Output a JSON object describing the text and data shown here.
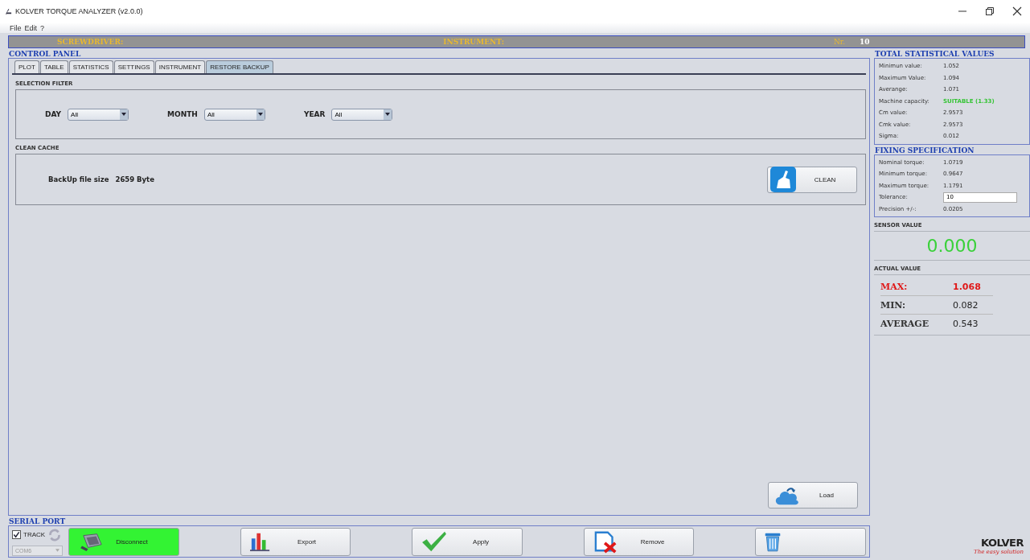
{
  "window": {
    "title": "KOLVER TORQUE ANALYZER (v2.0.0)"
  },
  "menu": [
    "File",
    "Edit",
    "?"
  ],
  "header": {
    "screwdriver_label": "SCREWDRIVER:",
    "instrument_label": "INSTRUMENT:",
    "nr_label": "Nr.",
    "nr_value": "10"
  },
  "control_panel": {
    "title": "CONTROL PANEL",
    "tabs": [
      {
        "label": "PLOT",
        "selected": false
      },
      {
        "label": "TABLE",
        "selected": false
      },
      {
        "label": "STATISTICS",
        "selected": false
      },
      {
        "label": "SETTINGS",
        "selected": false
      },
      {
        "label": "INSTRUMENT",
        "selected": false
      },
      {
        "label": "RESTORE BACKUP",
        "selected": true
      }
    ],
    "selection_filter": {
      "title": "SELECTION FILTER",
      "filters": [
        {
          "label": "DAY",
          "value": "All"
        },
        {
          "label": "MONTH",
          "value": "All"
        },
        {
          "label": "YEAR",
          "value": "All"
        }
      ]
    },
    "clean_cache": {
      "title": "CLEAN CACHE",
      "label": "BackUp file size",
      "value": "2659 Byte",
      "button": "CLEAN"
    },
    "load_button": "Load"
  },
  "serial_port": {
    "title": "SERIAL PORT",
    "track": {
      "label": "TRACK",
      "checked": true
    },
    "port": {
      "value": "COM6",
      "disabled": true
    },
    "connect_button": {
      "label": "Disconnect",
      "connected": true
    },
    "buttons": [
      {
        "kind": "export",
        "label": "Export"
      },
      {
        "kind": "apply",
        "label": "Apply"
      },
      {
        "kind": "remove",
        "label": "Remove"
      },
      {
        "kind": "trash"
      }
    ]
  },
  "total_statistical_values": {
    "title": "TOTAL STATISTICAL VALUES",
    "rows": [
      {
        "label": "Minimun value:",
        "value": "1.052",
        "highlight": false
      },
      {
        "label": "Maximum Value:",
        "value": "1.094",
        "highlight": false
      },
      {
        "label": "Averange:",
        "value": "1.071",
        "highlight": false
      },
      {
        "label": "Machine capacity:",
        "value": "SUITABLE (1.33)",
        "highlight": true
      },
      {
        "label": "Cm value:",
        "value": "2.9573",
        "highlight": false
      },
      {
        "label": "Cmk value:",
        "value": "2.9573",
        "highlight": false
      },
      {
        "label": "Sigma:",
        "value": "0.012",
        "highlight": false
      }
    ]
  },
  "fixing_specification": {
    "title": "FIXING SPECIFICATION",
    "rows": [
      {
        "kind": "text",
        "label": "Nominal torque:",
        "value": "1.0719"
      },
      {
        "kind": "text",
        "label": "Minimum torque:",
        "value": "0.9647"
      },
      {
        "kind": "text",
        "label": "Maximum torque:",
        "value": "1.1791"
      },
      {
        "kind": "input",
        "label": "Tolerance:",
        "value": "10"
      },
      {
        "kind": "text",
        "label": "Precision +/-:",
        "value": "0.0205"
      }
    ]
  },
  "sensor_value": {
    "title": "SENSOR VALUE",
    "value": "0.000"
  },
  "actual_value": {
    "title": "ACTUAL VALUE",
    "rows": [
      {
        "label": "MAX:",
        "value": "1.068",
        "alert": true
      },
      {
        "label": "MIN:",
        "value": "0.082",
        "alert": false
      },
      {
        "label": "AVERAGE",
        "value": "0.543",
        "alert": false
      }
    ]
  },
  "logo": {
    "name": "KOLVER",
    "tagline": "The easy solution"
  }
}
